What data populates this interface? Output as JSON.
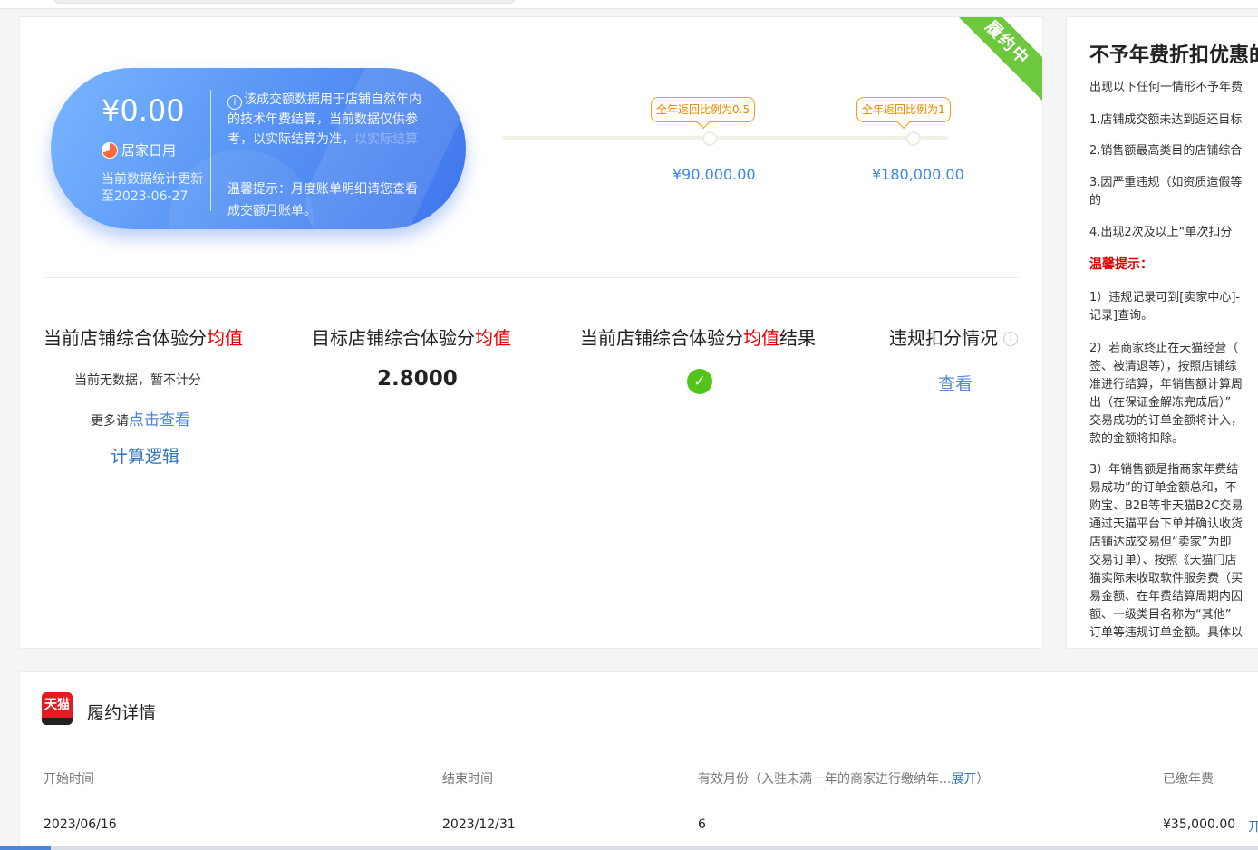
{
  "status_ribbon": "履约中",
  "capsule": {
    "amount": "¥0.00",
    "category": "居家日用",
    "update_text": "当前数据统计更新至2023-06-27",
    "info_text": "该成交额数据用于店铺自然年内的技术年费结算，当前数据仅供参考，以实际结算为准，",
    "info_fade": "以实际结算",
    "tip_text": "温馨提示：月度账单明细请您查看成交额月账单。"
  },
  "milestones": [
    {
      "label": "全年返回比例为0.5",
      "value": "¥90,000.00"
    },
    {
      "label": "全年返回比例为1",
      "value": "¥180,000.00"
    }
  ],
  "metrics": {
    "col1_prefix": "当前店铺综合体验分",
    "col1_red": "均值",
    "col2_prefix": "目标店铺综合体验分",
    "col2_red": "均值",
    "col3_prefix": "当前店铺综合体验分",
    "col3_red": "均值",
    "col3_suffix": "结果",
    "col4_title": "违规扣分情况",
    "no_data": "当前无数据，暂不计分",
    "more_prefix": "更多请",
    "more_link": "点击查看",
    "calc_link": "计算逻辑",
    "target_score": "2.8000",
    "view_link": "查看"
  },
  "side": {
    "title": "不予年费折扣优惠的",
    "intro": "出现以下任何一情形不予年费",
    "items": [
      "1.店铺成交额未达到返还目标",
      "2.销售额最高类目的店铺综合",
      "3.因严重违规（如资质造假等",
      "的",
      "4.出现2次及以上“单次扣分"
    ],
    "warm": "温馨提示：",
    "block1": [
      "1）违规记录可到[卖家中心]-",
      "记录]查询。"
    ],
    "block2": [
      "2）若商家终止在天猫经营（",
      "签、被清退等），按照店铺综",
      "准进行结算，年销售额计算周",
      "出（在保证金解冻完成后）”",
      "交易成功的订单金额将计入，",
      "款的金额将扣除。"
    ],
    "block3": [
      "3）年销售额是指商家年费结",
      "易成功”的订单金额总和，不",
      "购宝、B2B等非天猫B2C交易",
      "通过天猫平台下单并确认收货",
      "店铺达成交易但“卖家”为即",
      "交易订单）、按照《天猫门店",
      "猫实际未收取软件服务费（买",
      "易金额、在年费结算周期内因",
      "额、一级类目名称为“其他”",
      "订单等违规订单金额。具体以"
    ]
  },
  "fulfillment": {
    "logo_text": "天猫",
    "title": "履约详情",
    "headers": {
      "start": "开始时间",
      "end": "结束时间",
      "months_prefix": "有效月份（入驻未满一年的商家进行缴纳年...",
      "months_link": "展开",
      "months_suffix": "）",
      "paid": "已缴年费"
    },
    "row": {
      "start": "2023/06/16",
      "end": "2023/12/31",
      "months": "6",
      "paid": "¥35,000.00",
      "action": "开"
    }
  }
}
